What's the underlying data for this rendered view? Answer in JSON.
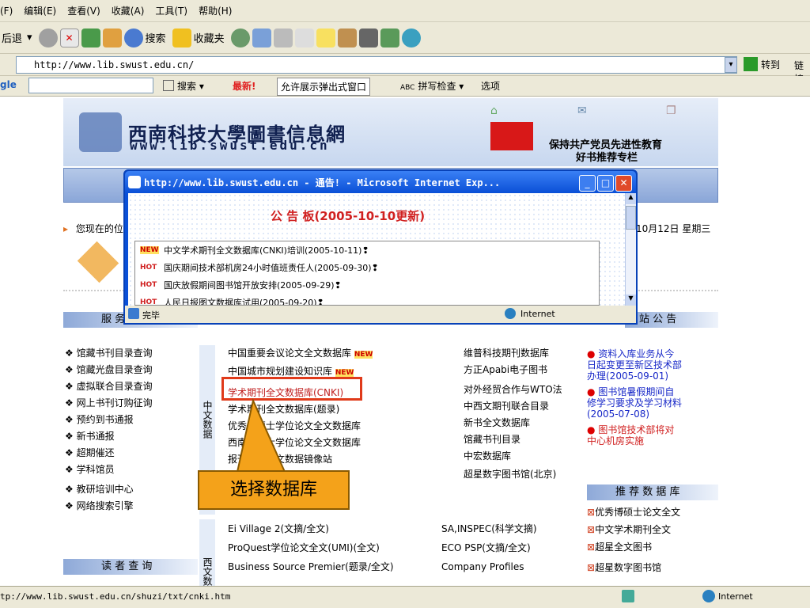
{
  "menus": [
    "(F)",
    "编辑(E)",
    "查看(V)",
    "收藏(A)",
    "工具(T)",
    "帮助(H)"
  ],
  "toolbar": {
    "back": "后退",
    "search": "搜索",
    "favorites": "收藏夹"
  },
  "address": {
    "url": "http://www.lib.swust.edu.cn/",
    "go": "转到",
    "links": "链接"
  },
  "google": {
    "label": "gle",
    "search": "搜索",
    "newest": "最新!",
    "popup": "允许展示弹出式窗口",
    "spell": "拼写检查",
    "options": "选项"
  },
  "banner": {
    "title": "西南科技大學圖書信息網",
    "url": "www.lib.swust.edu.cn",
    "slogan1": "保持共产党员先进性教育",
    "slogan2": "好书推荐专栏"
  },
  "popup": {
    "title": "http://www.lib.swust.edu.cn - 通告! - Microsoft Internet Exp...",
    "heading": "公 告 板(2005-10-10更新)",
    "status": "完毕",
    "zone": "Internet",
    "items": [
      {
        "tag": "NEW",
        "text": "中文学术期刊全文数据库(CNKI)培训(2005-10-11)❢"
      },
      {
        "tag": "HOT",
        "text": "国庆期间技术部机房24小时值班责任人(2005-09-30)❢"
      },
      {
        "tag": "HOT",
        "text": "国庆放假期间图书馆开放安排(2005-09-29)❢"
      },
      {
        "tag": "HOT",
        "text": "人民日报图文数据库试用(2005-09-20)❢"
      }
    ]
  },
  "location": {
    "label": "您现在的位",
    "date": "年10月12日 星期三"
  },
  "sections": {
    "service": "服 务",
    "notice": "站 公 告",
    "reader": "读 者 查 询",
    "recommend": "推 荐 数 据 库"
  },
  "left_links": [
    "馆藏书刊目录查询",
    "馆藏光盘目录查询",
    "虚拟联合目录查询",
    "网上书刊订购征询",
    "预约到书通报",
    "新书通报",
    "超期催还",
    "学科馆员",
    "教研培训中心",
    "网络搜索引擎"
  ],
  "cn_db_label": "中文数据",
  "mid_links": [
    "中国重要会议论文全文数据库",
    "中国城市规划建设知识库",
    "学术期刊全文数据库(CNKI)",
    "学术期刊全文数据库(题录)",
    "优秀博硕士学位论文全文数据库",
    "西南博硕士学位论文全文数据库",
    "报刊资料全文数据镜像站",
    "图书馆书目数据库"
  ],
  "right_links": [
    "维普科技期刊数据库",
    "方正Apabi电子图书",
    "对外经贸合作与WTO法",
    "中西文期刊联合目录",
    "新书全文数据库",
    "馆藏书刊目录",
    "中宏数据库",
    "超星数字图书馆(北京)"
  ],
  "news": [
    "资料入库业务从今日起变更至新区技术部办理(2005-09-01)",
    "图书馆暑假期间自修学习要求及学习材料(2005-07-08)",
    "图书馆技术部将对中心机房实施"
  ],
  "rec_db": [
    "优秀博硕士论文全文",
    "中文学术期刊全文",
    "超星全文图书",
    "超星数字图书馆"
  ],
  "west_label": "西文数",
  "west_links": [
    "Ei Village 2(文摘/全文)",
    "ProQuest学位论文全文(UMI)(全文)",
    "Business Source Premier(题录/全文)"
  ],
  "west_right": [
    "SA,INSPEC(科学文摘)",
    "ECO PSP(文摘/全文)",
    "Company Profiles"
  ],
  "callout": "选择数据库",
  "statusbar": {
    "url": "tp://www.lib.swust.edu.cn/shuzi/txt/cnki.htm",
    "zone": "Internet"
  },
  "colors": {
    "accent": "#0a50d8",
    "red": "#e03a1a",
    "orange": "#f4a21a"
  }
}
